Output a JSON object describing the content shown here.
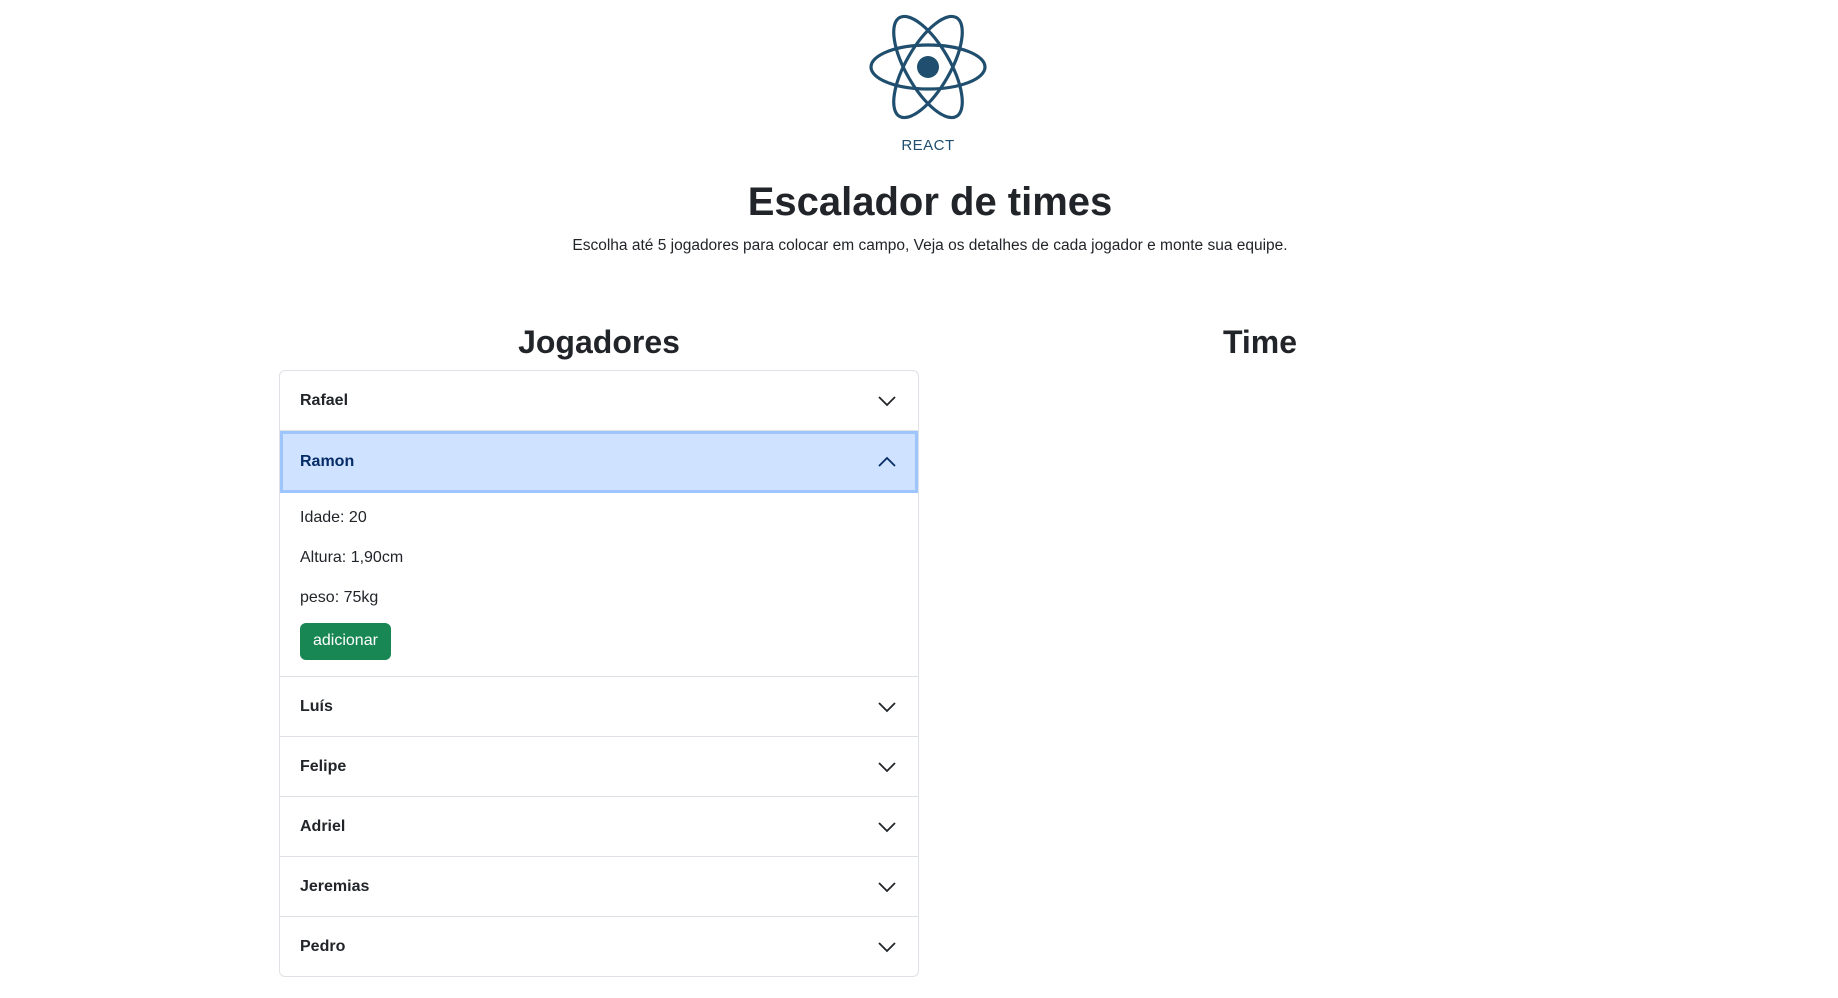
{
  "logo": {
    "label": "REACT",
    "color": "#1f4e6e",
    "icon": "react-atom-icon"
  },
  "title": "Escalador de times",
  "subtitle": "Escolha até 5 jogadores para colocar em campo, Veja os detalhes de cada jogador e monte sua equipe.",
  "columns": {
    "players_title": "Jogadores",
    "team_title": "Time"
  },
  "players": [
    {
      "name": "Rafael",
      "expanded": false
    },
    {
      "name": "Ramon",
      "expanded": true,
      "details": {
        "idade": "Idade: 20",
        "altura": "Altura: 1,90cm",
        "peso": "peso: 75kg"
      },
      "add_label": "adicionar"
    },
    {
      "name": "Luís",
      "expanded": false
    },
    {
      "name": "Felipe",
      "expanded": false
    },
    {
      "name": "Adriel",
      "expanded": false
    },
    {
      "name": "Jeremias",
      "expanded": false
    },
    {
      "name": "Pedro",
      "expanded": false
    }
  ],
  "colors": {
    "accent_bg": "#cfe2ff",
    "button": "#198754",
    "border": "#dee2e6"
  }
}
